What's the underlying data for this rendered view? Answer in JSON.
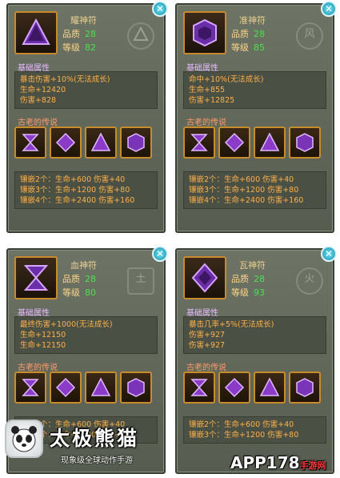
{
  "panels": [
    {
      "name": "yao-shen-fu",
      "title": "耀神符",
      "quality_label": "品质",
      "quality_value": "28",
      "level_label": "等级",
      "level_value": "82",
      "emblem": "",
      "section_title": "基础属性",
      "attrs": [
        "暴击伤害+10%(无法成长)",
        "生命+12420",
        "伤害+828"
      ],
      "legend_title": "古老的传说",
      "gem_tag": "",
      "sets": [
        "镶嵌2个：生命+600 伤害+40",
        "镶嵌3个：生命+1200 伤害+80",
        "镶嵌4个：生命+2400 伤害+160"
      ]
    },
    {
      "name": "zhun-shen-fu",
      "title": "准神符",
      "quality_label": "品质",
      "quality_value": "28",
      "level_label": "等级",
      "level_value": "85",
      "emblem": "风",
      "section_title": "基础属性",
      "attrs": [
        "命中+10%(无法成长)",
        "生命+855",
        "伤害+12825"
      ],
      "legend_title": "古老的传说",
      "gem_tag": "",
      "sets": [
        "镶嵌2个：生命+600 伤害+40",
        "镶嵌3个：生命+1200 伤害+80",
        "镶嵌4个：生命+2400 伤害+160"
      ]
    },
    {
      "name": "xue-shen-fu",
      "title": "血神符",
      "quality_label": "品质",
      "quality_value": "28",
      "level_label": "等级",
      "level_value": "80",
      "emblem": "土",
      "section_title": "基础属性",
      "attrs": [
        "最终伤害+1000(无法成长)",
        "生命+12150",
        "生命+12150"
      ],
      "legend_title": "古老的传说",
      "gem_tag": "",
      "sets": [
        "镶嵌2个：生命+600 伤害+40",
        "镶嵌3个：生命+1200 伤害+80"
      ]
    },
    {
      "name": "wa-shen-fu",
      "title": "瓦神符",
      "quality_label": "品质",
      "quality_value": "28",
      "level_label": "等级",
      "level_value": "93",
      "emblem": "火",
      "section_title": "基础属性",
      "attrs": [
        "暴击几率+5%(无法成长)",
        "伤害+927",
        "伤害+927"
      ],
      "legend_title": "古老的传说",
      "gem_tag": "",
      "sets": [
        "镶嵌2个：生命+600 伤害+40",
        "镶嵌3个：生命+1200 伤害+80"
      ]
    }
  ],
  "close_glyph": "✕",
  "watermark": {
    "game_title": "太极熊猫",
    "game_sub": "现象级全球动作手游",
    "site_a": "APP178",
    "site_b": "手游网"
  },
  "colors": {
    "panel": "#5f6658",
    "gold_border": "#c98a2d",
    "value_green": "#4ce04c",
    "attr_orange": "#ffb04a",
    "gem_purple": "#8a3cc8"
  }
}
